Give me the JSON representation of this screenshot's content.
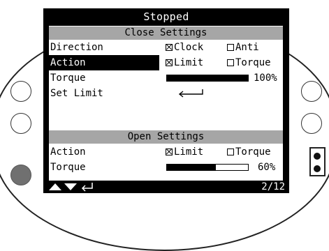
{
  "header": {
    "status": "Stopped"
  },
  "close_settings": {
    "title": "Close Settings",
    "direction": {
      "label": "Direction",
      "opt1": "Clock",
      "opt1_checked": true,
      "opt2": "Anti",
      "opt2_checked": false
    },
    "action": {
      "label": "Action",
      "selected": true,
      "opt1": "Limit",
      "opt1_checked": true,
      "opt2": "Torque",
      "opt2_checked": false
    },
    "torque": {
      "label": "Torque",
      "percent_text": "100%",
      "level": 1.0
    },
    "set_limit": {
      "label": "Set Limit",
      "icon": "enter-arrow-icon"
    }
  },
  "open_settings": {
    "title": "Open Settings",
    "action": {
      "label": "Action",
      "selected": false,
      "opt1": "Limit",
      "opt1_checked": true,
      "opt2": "Torque",
      "opt2_checked": false
    },
    "torque": {
      "label": "Torque",
      "percent_text": "60%",
      "level": 0.6
    }
  },
  "footer": {
    "nav_icons": [
      "up-arrow-icon",
      "down-arrow-icon",
      "enter-icon"
    ],
    "page": "2/12"
  },
  "colors": {
    "screen_bg": "#ffffff",
    "lcd_frame": "#000000",
    "section_bg": "#a6a6a6",
    "button_dark": "#707070"
  }
}
